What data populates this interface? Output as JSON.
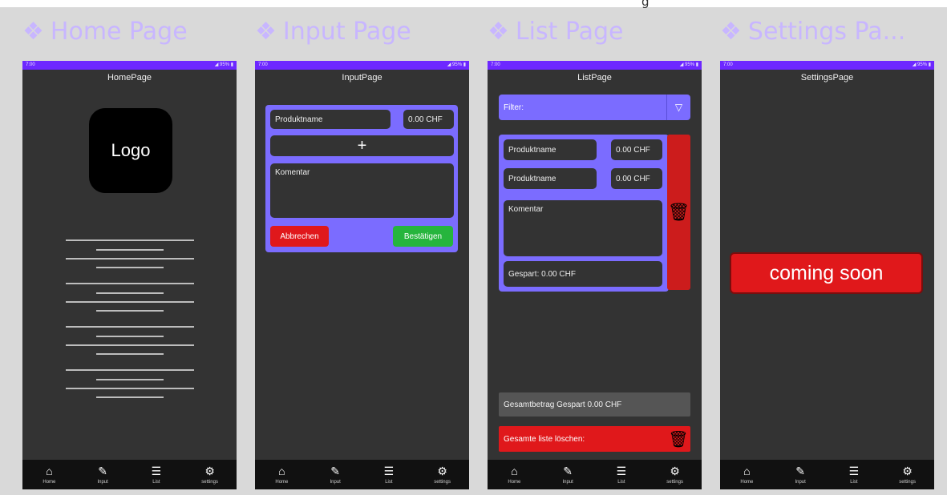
{
  "top_cut_text": "g",
  "frames": [
    {
      "title": "Home Page",
      "page_title": "HomePage"
    },
    {
      "title": "Input Page",
      "page_title": "InputPage"
    },
    {
      "title": "List Page",
      "page_title": "ListPage"
    },
    {
      "title": "Settings Pa...",
      "page_title": "SettingsPage"
    }
  ],
  "statusbar": {
    "time": "7:00",
    "right": "◢ 95% ▮"
  },
  "nav": [
    {
      "icon": "⌂",
      "label": "Home",
      "icon_name": "home-icon"
    },
    {
      "icon": "✎",
      "label": "Input",
      "icon_name": "pencil-icon"
    },
    {
      "icon": "☰",
      "label": "List",
      "icon_name": "list-icon"
    },
    {
      "icon": "⚙",
      "label": "settings",
      "icon_name": "gear-icon"
    }
  ],
  "home": {
    "logo": "Logo"
  },
  "input": {
    "product_placeholder": "Produktname",
    "price": "0.00 CHF",
    "plus": "+",
    "comment_placeholder": "Komentar",
    "cancel": "Abbrechen",
    "confirm": "Bestätigen"
  },
  "list": {
    "filter": "Filter:",
    "filter_icon": "▽",
    "product1": "Produktname",
    "price1": "0.00 CHF",
    "product2": "Produktname",
    "price2": "0.00 CHF",
    "comment": "Komentar",
    "saved": "Gespart: 0.00 CHF",
    "trash": "🗑",
    "total": "Gesamtbetrag Gespart 0.00 CHF",
    "delete_all": "Gesamte liste löschen:"
  },
  "settings": {
    "coming_soon": "coming soon"
  },
  "colors": {
    "accent_purple": "#7b6cff",
    "statusbar": "#6d28ff",
    "danger_red": "#e0181b",
    "confirm_green": "#26b53d",
    "phone_bg": "#333333"
  }
}
